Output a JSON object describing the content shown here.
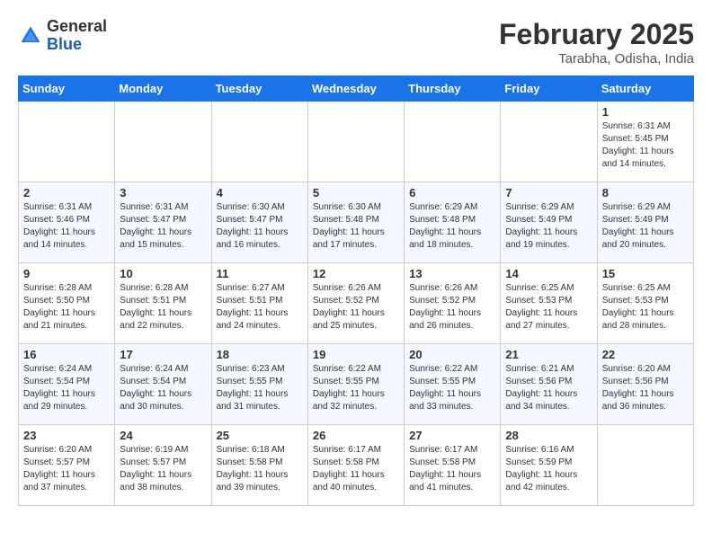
{
  "header": {
    "logo_line1": "General",
    "logo_line2": "Blue",
    "month": "February 2025",
    "location": "Tarabha, Odisha, India"
  },
  "weekdays": [
    "Sunday",
    "Monday",
    "Tuesday",
    "Wednesday",
    "Thursday",
    "Friday",
    "Saturday"
  ],
  "weeks": [
    [
      {
        "day": "",
        "info": ""
      },
      {
        "day": "",
        "info": ""
      },
      {
        "day": "",
        "info": ""
      },
      {
        "day": "",
        "info": ""
      },
      {
        "day": "",
        "info": ""
      },
      {
        "day": "",
        "info": ""
      },
      {
        "day": "1",
        "info": "Sunrise: 6:31 AM\nSunset: 5:45 PM\nDaylight: 11 hours and 14 minutes."
      }
    ],
    [
      {
        "day": "2",
        "info": "Sunrise: 6:31 AM\nSunset: 5:46 PM\nDaylight: 11 hours and 14 minutes."
      },
      {
        "day": "3",
        "info": "Sunrise: 6:31 AM\nSunset: 5:47 PM\nDaylight: 11 hours and 15 minutes."
      },
      {
        "day": "4",
        "info": "Sunrise: 6:30 AM\nSunset: 5:47 PM\nDaylight: 11 hours and 16 minutes."
      },
      {
        "day": "5",
        "info": "Sunrise: 6:30 AM\nSunset: 5:48 PM\nDaylight: 11 hours and 17 minutes."
      },
      {
        "day": "6",
        "info": "Sunrise: 6:29 AM\nSunset: 5:48 PM\nDaylight: 11 hours and 18 minutes."
      },
      {
        "day": "7",
        "info": "Sunrise: 6:29 AM\nSunset: 5:49 PM\nDaylight: 11 hours and 19 minutes."
      },
      {
        "day": "8",
        "info": "Sunrise: 6:29 AM\nSunset: 5:49 PM\nDaylight: 11 hours and 20 minutes."
      }
    ],
    [
      {
        "day": "9",
        "info": "Sunrise: 6:28 AM\nSunset: 5:50 PM\nDaylight: 11 hours and 21 minutes."
      },
      {
        "day": "10",
        "info": "Sunrise: 6:28 AM\nSunset: 5:51 PM\nDaylight: 11 hours and 22 minutes."
      },
      {
        "day": "11",
        "info": "Sunrise: 6:27 AM\nSunset: 5:51 PM\nDaylight: 11 hours and 24 minutes."
      },
      {
        "day": "12",
        "info": "Sunrise: 6:26 AM\nSunset: 5:52 PM\nDaylight: 11 hours and 25 minutes."
      },
      {
        "day": "13",
        "info": "Sunrise: 6:26 AM\nSunset: 5:52 PM\nDaylight: 11 hours and 26 minutes."
      },
      {
        "day": "14",
        "info": "Sunrise: 6:25 AM\nSunset: 5:53 PM\nDaylight: 11 hours and 27 minutes."
      },
      {
        "day": "15",
        "info": "Sunrise: 6:25 AM\nSunset: 5:53 PM\nDaylight: 11 hours and 28 minutes."
      }
    ],
    [
      {
        "day": "16",
        "info": "Sunrise: 6:24 AM\nSunset: 5:54 PM\nDaylight: 11 hours and 29 minutes."
      },
      {
        "day": "17",
        "info": "Sunrise: 6:24 AM\nSunset: 5:54 PM\nDaylight: 11 hours and 30 minutes."
      },
      {
        "day": "18",
        "info": "Sunrise: 6:23 AM\nSunset: 5:55 PM\nDaylight: 11 hours and 31 minutes."
      },
      {
        "day": "19",
        "info": "Sunrise: 6:22 AM\nSunset: 5:55 PM\nDaylight: 11 hours and 32 minutes."
      },
      {
        "day": "20",
        "info": "Sunrise: 6:22 AM\nSunset: 5:55 PM\nDaylight: 11 hours and 33 minutes."
      },
      {
        "day": "21",
        "info": "Sunrise: 6:21 AM\nSunset: 5:56 PM\nDaylight: 11 hours and 34 minutes."
      },
      {
        "day": "22",
        "info": "Sunrise: 6:20 AM\nSunset: 5:56 PM\nDaylight: 11 hours and 36 minutes."
      }
    ],
    [
      {
        "day": "23",
        "info": "Sunrise: 6:20 AM\nSunset: 5:57 PM\nDaylight: 11 hours and 37 minutes."
      },
      {
        "day": "24",
        "info": "Sunrise: 6:19 AM\nSunset: 5:57 PM\nDaylight: 11 hours and 38 minutes."
      },
      {
        "day": "25",
        "info": "Sunrise: 6:18 AM\nSunset: 5:58 PM\nDaylight: 11 hours and 39 minutes."
      },
      {
        "day": "26",
        "info": "Sunrise: 6:17 AM\nSunset: 5:58 PM\nDaylight: 11 hours and 40 minutes."
      },
      {
        "day": "27",
        "info": "Sunrise: 6:17 AM\nSunset: 5:58 PM\nDaylight: 11 hours and 41 minutes."
      },
      {
        "day": "28",
        "info": "Sunrise: 6:16 AM\nSunset: 5:59 PM\nDaylight: 11 hours and 42 minutes."
      },
      {
        "day": "",
        "info": ""
      }
    ]
  ]
}
